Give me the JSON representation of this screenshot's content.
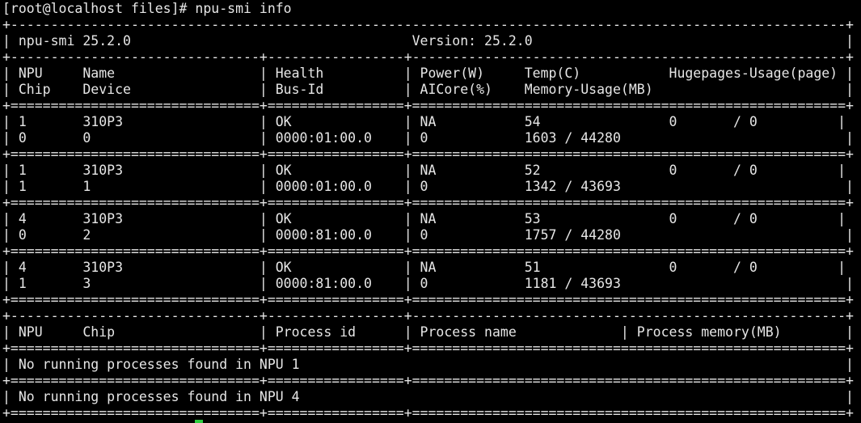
{
  "terminal": {
    "lines": [
      "[root@localhost files]# npu-smi info",
      "+--------------------------------------------------------------------------------------------------------+",
      "| npu-smi 25.2.0                                   Version: 25.2.0                                       |",
      "+-------------------------------+-----------------+------------------------------------------------------+",
      "| NPU     Name                  | Health          | Power(W)     Temp(C)           Hugepages-Usage(page) |",
      "| Chip    Device                | Bus-Id          | AICore(%)    Memory-Usage(MB)                        |",
      "+===============================+=================+======================================================+",
      "| 1       310P3                 | OK              | NA           54                0       / 0          |",
      "| 0       0                     | 0000:01:00.0    | 0            1603 / 44280                            |",
      "+===============================+=================+======================================================+",
      "| 1       310P3                 | OK              | NA           52                0       / 0          |",
      "| 1       1                     | 0000:01:00.0    | 0            1342 / 43693                            |",
      "+===============================+=================+======================================================+",
      "| 4       310P3                 | OK              | NA           53                0       / 0          |",
      "| 0       2                     | 0000:81:00.0    | 0            1757 / 44280                            |",
      "+===============================+=================+======================================================+",
      "| 4       310P3                 | OK              | NA           51                0       / 0          |",
      "| 1       3                     | 0000:81:00.0    | 0            1181 / 43693                            |",
      "+===============================+=================+======================================================+",
      "+-------------------------------+-----------------+------------------------------------------------------+",
      "| NPU     Chip                  | Process id      | Process name             | Process memory(MB)        |",
      "+===============================+=================+======================================================+",
      "| No running processes found in NPU 1                                                                    |",
      "+===============================+=================+======================================================+",
      "| No running processes found in NPU 4                                                                    |",
      "+===============================+=================+======================================================+"
    ]
  },
  "colors": {
    "background": "#000000",
    "foreground": "#e6e6e6",
    "cursor": "#2ecc40"
  }
}
